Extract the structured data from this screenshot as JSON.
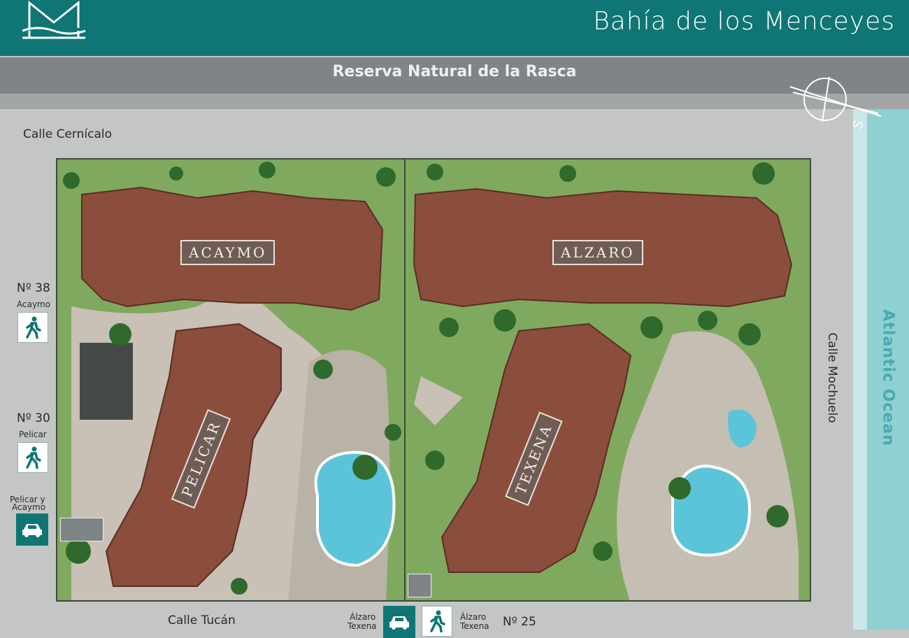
{
  "header": {
    "title": "Bahía de los Menceyes",
    "logo_icon": "menceyes-logo-icon"
  },
  "reserve": {
    "label": "Reserva Natural de la Rasca"
  },
  "compass": {
    "letter": "S"
  },
  "ocean": {
    "label": "Atlantic Ocean"
  },
  "streets": {
    "cernicalo": "Calle Cernícalo",
    "tucan": "Calle Tucán",
    "mochuelo": "Calle Mochuelo"
  },
  "buildings": {
    "acaymo": "ACAYMO",
    "alzaro": "ALZARO",
    "pelicar": "PELICAR",
    "texena": "TEXENA"
  },
  "entrances": {
    "acaymo": {
      "number": "Nº 38",
      "name": "Acaymo",
      "icon": "pedestrian-icon"
    },
    "pelicar": {
      "number": "Nº 30",
      "name": "Pelicar",
      "icon": "pedestrian-icon"
    },
    "parking_west": {
      "name_line1": "Pelicar y",
      "name_line2": "Acaymo",
      "icon": "car-icon"
    },
    "parking_south": {
      "name_line1": "Álzaro",
      "name_line2": "Texena",
      "icon": "car-icon"
    },
    "walk_south": {
      "name_line1": "Álzaro",
      "name_line2": "Texena",
      "number": "Nº 25",
      "icon": "pedestrian-icon"
    }
  },
  "colors": {
    "header": "#0f7575",
    "roof": "#8b4d3c",
    "garden": "#7fa95f",
    "pool": "#5cc4d8",
    "ocean": "#8fd0d3"
  }
}
